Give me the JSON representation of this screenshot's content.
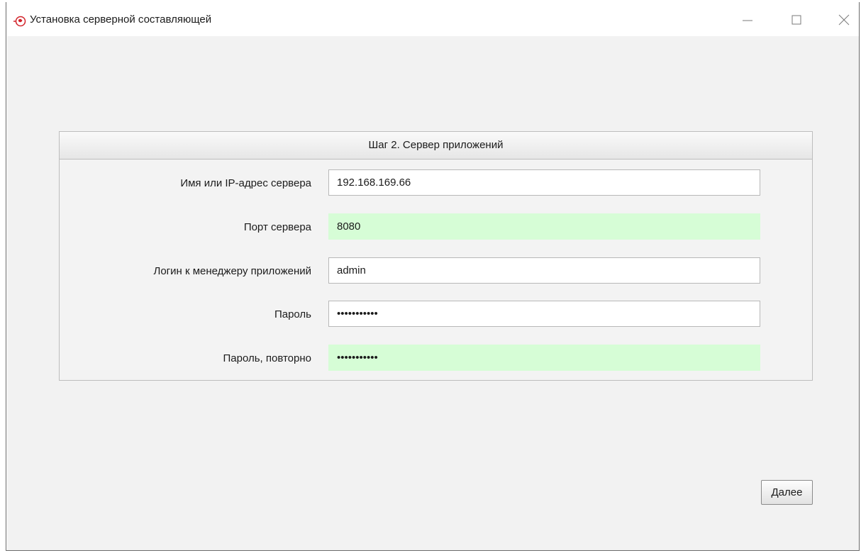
{
  "window": {
    "title": "Установка серверной составляющей"
  },
  "panel": {
    "header": "Шаг 2. Сервер приложений"
  },
  "fields": [
    {
      "label": "Имя или IP-адрес сервера",
      "value": "192.168.169.66",
      "type": "text",
      "highlighted": false
    },
    {
      "label": "Порт сервера",
      "value": "8080",
      "type": "text",
      "highlighted": true
    },
    {
      "label": "Логин к менеджеру приложений",
      "value": "admin",
      "type": "text",
      "highlighted": false
    },
    {
      "label": "Пароль",
      "value": "admin123456",
      "type": "password",
      "highlighted": false
    },
    {
      "label": "Пароль, повторно",
      "value": "admin123456",
      "type": "password",
      "highlighted": true
    }
  ],
  "buttons": {
    "next_label": "Далее"
  },
  "colors": {
    "valid_field_bg": "#d6fdd6",
    "client_bg": "#f2f2f2",
    "app_icon": "#d2232a"
  },
  "icons": {
    "app": "app-logo-icon",
    "minimize": "minimize-icon",
    "maximize": "maximize-icon",
    "close": "close-icon"
  }
}
